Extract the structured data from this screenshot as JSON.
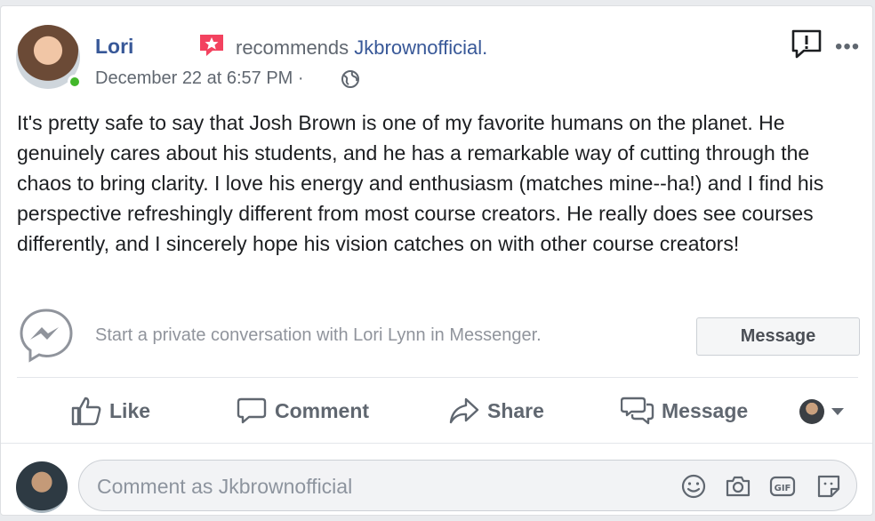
{
  "post": {
    "author": "Lori",
    "recommends_label": "recommends",
    "recommended_page": "Jkbrownofficial.",
    "timestamp": "December 22 at 6:57 PM ·",
    "body": "It's pretty safe to say that Josh Brown is one of my favorite humans on the planet. He genuinely cares about his students, and he has a remarkable way of cutting through the chaos to bring clarity. I love his energy and enthusiasm (matches mine--ha!) and I find his perspective refreshingly different from most course creators. He really does see courses differently, and I sincerely hope his vision catches on with other course creators!"
  },
  "messenger": {
    "prompt": "Start a private conversation with Lori Lynn in Messenger.",
    "button_label": "Message"
  },
  "actions": {
    "like": "Like",
    "comment": "Comment",
    "share": "Share",
    "message": "Message"
  },
  "composer": {
    "placeholder": "Comment as Jkbrownofficial"
  },
  "icons": {
    "recommend": "recommendation-star-icon",
    "privacy": "globe-icon",
    "report": "report-icon",
    "more": "more-options-icon"
  },
  "colors": {
    "link": "#385898",
    "secondary_text": "#606770",
    "online": "#42b72a",
    "recommend_badge": "#f3425f"
  }
}
